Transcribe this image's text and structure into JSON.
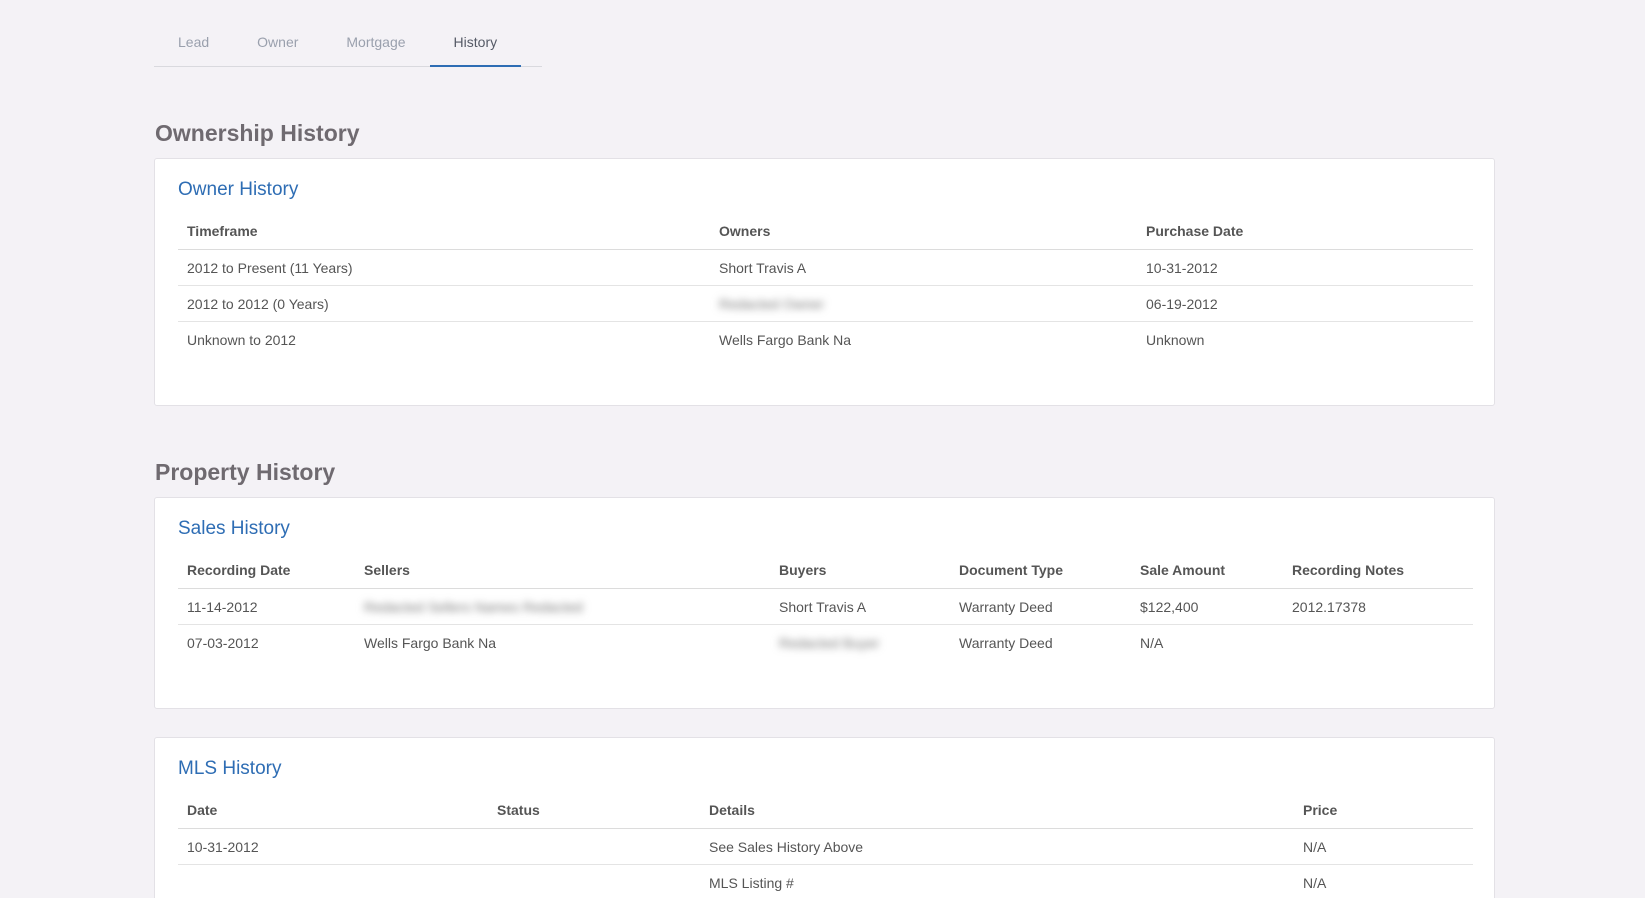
{
  "tabs": [
    {
      "label": "Lead",
      "active": false
    },
    {
      "label": "Owner",
      "active": false
    },
    {
      "label": "Mortgage",
      "active": false
    },
    {
      "label": "History",
      "active": true
    }
  ],
  "ownership": {
    "section_title": "Ownership History",
    "owner_history": {
      "title": "Owner History",
      "columns": [
        "Timeframe",
        "Owners",
        "Purchase Date"
      ],
      "rows": [
        {
          "timeframe": "2012 to Present (11 Years)",
          "owners": "Short Travis A",
          "purchase_date": "10-31-2012"
        },
        {
          "timeframe": "2012 to 2012 (0 Years)",
          "owners": "Redacted Owner",
          "purchase_date": "06-19-2012"
        },
        {
          "timeframe": "Unknown to 2012",
          "owners": "Wells Fargo Bank Na",
          "purchase_date": "Unknown"
        }
      ]
    }
  },
  "property": {
    "section_title": "Property History",
    "sales_history": {
      "title": "Sales History",
      "columns": [
        "Recording Date",
        "Sellers",
        "Buyers",
        "Document Type",
        "Sale Amount",
        "Recording Notes"
      ],
      "rows": [
        {
          "recording_date": "11-14-2012",
          "sellers": "Redacted Sellers Names Redacted",
          "buyers": "Short Travis A",
          "document_type": "Warranty Deed",
          "sale_amount": "$122,400",
          "recording_notes": "2012.17378"
        },
        {
          "recording_date": "07-03-2012",
          "sellers": "Wells Fargo Bank Na",
          "buyers": "Redacted Buyer",
          "document_type": "Warranty Deed",
          "sale_amount": "N/A",
          "recording_notes": ""
        }
      ]
    },
    "mls_history": {
      "title": "MLS History",
      "columns": [
        "Date",
        "Status",
        "Details",
        "Price"
      ],
      "rows": [
        {
          "date": "10-31-2012",
          "status": "",
          "details": "See Sales History Above",
          "price": "N/A"
        },
        {
          "date": "",
          "status": "",
          "details": "MLS Listing #",
          "price": "N/A"
        }
      ]
    }
  },
  "colors": {
    "background": "#f4f2f6",
    "accent": "#2e6db4",
    "heading": "#6f6a70"
  }
}
